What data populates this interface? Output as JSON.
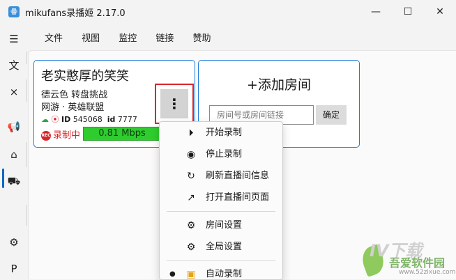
{
  "window": {
    "title": "mikufans录播姬 2.17.0",
    "app_icon": "ꙮ"
  },
  "menu": [
    "文件",
    "视图",
    "监控",
    "链接",
    "赞助"
  ],
  "room": {
    "name": "老实憨厚的笑笑",
    "title": "德云色  转盘挑战",
    "area": "网游 · 英雄联盟",
    "id_label": "ID",
    "room_id": "545068",
    "short_id_label": "id",
    "short_id": "7777",
    "rec_badge": "REC",
    "rec_status": "录制中",
    "rate": "0.81 Mbps"
  },
  "add_room": {
    "title": "+添加房间",
    "placeholder": "房间号或房间链接",
    "confirm": "确定"
  },
  "context_menu": {
    "start": "开始录制",
    "stop": "停止录制",
    "refresh": "刷新直播间信息",
    "open": "打开直播间页面",
    "room_settings": "房间设置",
    "global_settings": "全局设置",
    "auto_record": "自动录制"
  },
  "watermark": {
    "logo": "IV下载",
    "text": "吾爱软件园",
    "url": "www.52zixue.com"
  },
  "colors": {
    "accent": "#1f7ad8",
    "rec": "#d8262b",
    "rate_bg": "#2ecc2e",
    "highlight": "#d8262b"
  }
}
